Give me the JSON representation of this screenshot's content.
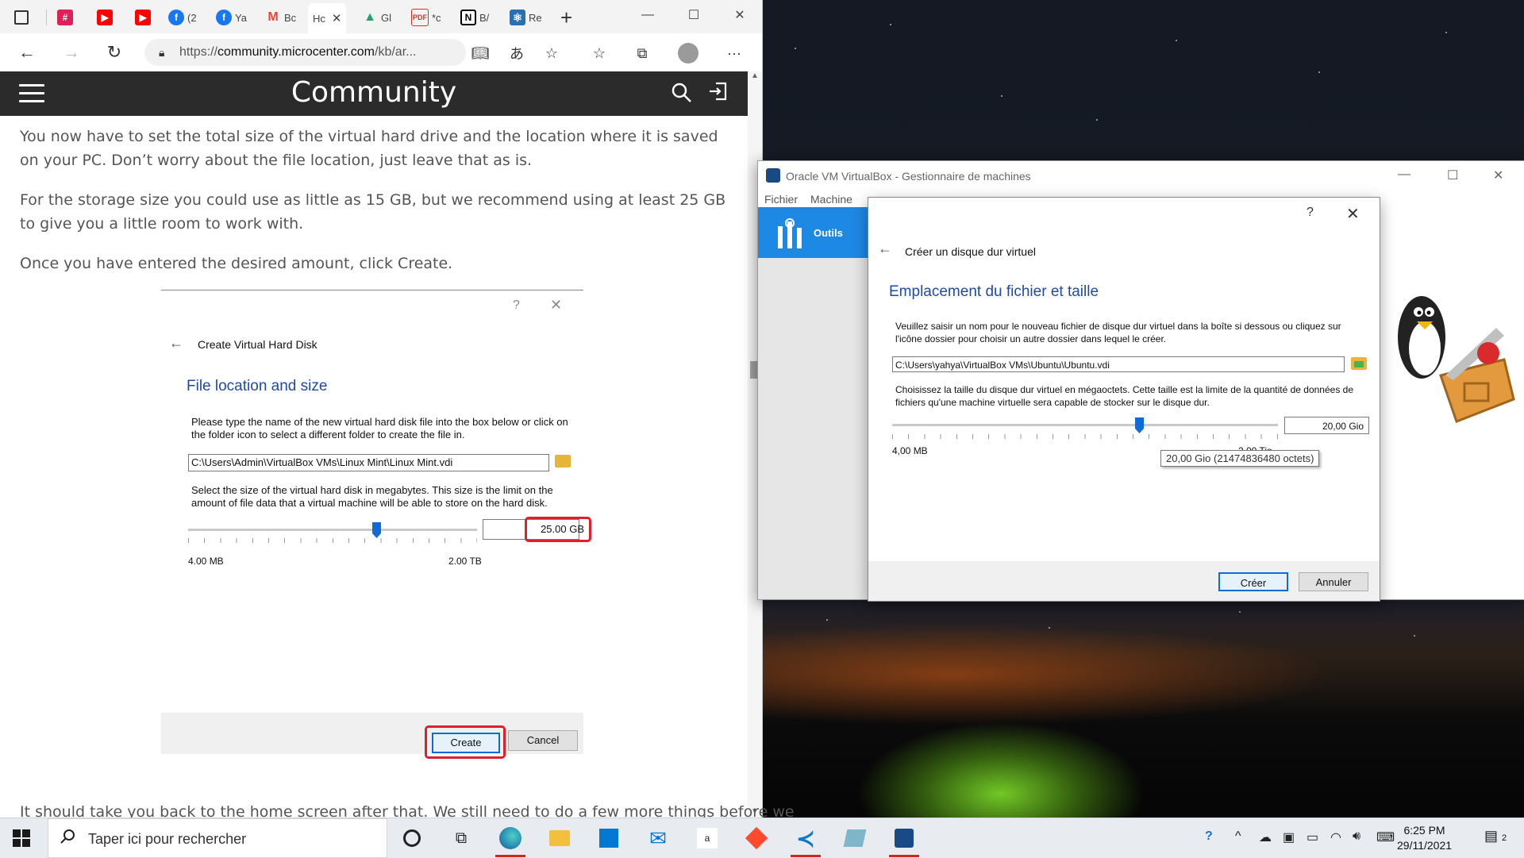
{
  "browser": {
    "tabs": [
      {
        "label": "",
        "icon": "tab-actions-icon"
      },
      {
        "label": "",
        "icon": "slack-icon",
        "color": "#4a154b"
      },
      {
        "label": "",
        "icon": "youtube-icon",
        "color": "#ff0000"
      },
      {
        "label": "",
        "icon": "youtube-icon",
        "color": "#ff0000"
      },
      {
        "label": "(2",
        "icon": "facebook-icon",
        "color": "#1877f2"
      },
      {
        "label": "Ya",
        "icon": "facebook-icon",
        "color": "#1877f2"
      },
      {
        "label": "Bc",
        "icon": "gmail-icon",
        "color": "#ea4335"
      },
      {
        "label": "Hc",
        "icon": "page-icon",
        "active": true
      },
      {
        "label": "Gl",
        "icon": "google-drive-icon",
        "color": "#1fa463"
      },
      {
        "label": "*c",
        "icon": "pdf-icon",
        "color": "#d93025"
      },
      {
        "label": "B/",
        "icon": "notion-icon",
        "color": "#000000"
      },
      {
        "label": "Re",
        "icon": "react-icon",
        "color": "#2a6fb0"
      }
    ],
    "url": {
      "prefix": "https://",
      "domain": "community.microcenter.com",
      "path": "/kb/ar..."
    },
    "site_title": "Community",
    "article": {
      "p1": "You now have to set the total size of the virtual hard drive and the location where it is saved on your PC. Don’t worry about the file location, just leave that as is.",
      "p2": "For the storage size you could use as little as 15 GB, but we recommend using at least 25 GB to give you a little room to work with.",
      "p3": "Once you have entered the desired amount, click Create.",
      "cutoff": "It should take you back to the home screen after that. We still need to do a few more things before we"
    },
    "embedded_dialog": {
      "help": "?",
      "title": "Create Virtual Hard Disk",
      "heading": "File location and size",
      "desc1": "Please type the name of the new virtual hard disk file into the box below or click on the folder icon to select a different folder to create the file in.",
      "file_path": "C:\\Users\\Admin\\VirtualBox VMs\\Linux Mint\\Linux Mint.vdi",
      "desc2": "Select the size of the virtual hard disk in megabytes. This size is the limit on the amount of file data that a virtual machine will be able to store on the hard disk.",
      "size_value": "25.00 GB",
      "min_label": "4.00 MB",
      "max_label": "2.00 TB",
      "create_label": "Create",
      "cancel_label": "Cancel"
    }
  },
  "virtualbox": {
    "title": "Oracle VM VirtualBox - Gestionnaire de machines",
    "menu": [
      "Fichier",
      "Machine"
    ],
    "tools_label": "Outils"
  },
  "dialog": {
    "help": "?",
    "title": "Créer un disque dur virtuel",
    "heading": "Emplacement du fichier et taille",
    "desc1": "Veuillez saisir un nom pour le nouveau fichier de disque dur virtuel dans la boîte si dessous ou cliquez sur l'icône dossier pour choisir un autre dossier dans lequel le créer.",
    "file_path": "C:\\Users\\yahya\\VirtualBox VMs\\Ubuntu\\Ubuntu.vdi",
    "desc2": "Choisissez la taille du disque dur virtuel en mégaoctets. Cette taille est la limite de la quantité de données de fichiers qu'une machine virtuelle sera capable de stocker sur le disque dur.",
    "size_value": "20,00 Gio",
    "min_label": "4,00 MB",
    "max_label": "2,00 Tio",
    "tooltip": "20,00 Gio (21474836480 octets)",
    "create_label": "Créer",
    "cancel_label": "Annuler"
  },
  "taskbar": {
    "search_placeholder": "Taper ici pour rechercher",
    "time": "6:25 PM",
    "date": "29/11/2021",
    "notification_count": "2"
  }
}
